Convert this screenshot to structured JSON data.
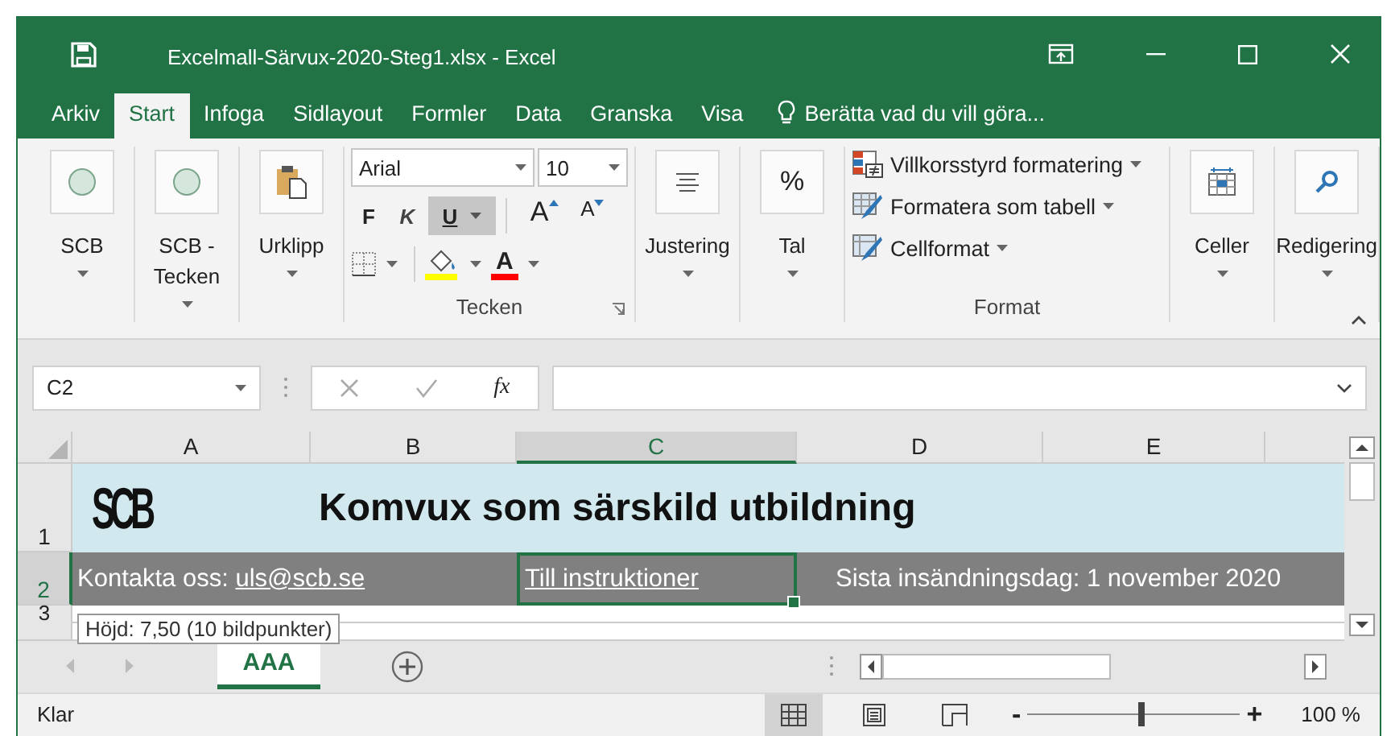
{
  "window": {
    "title": "Excelmall-Särvux-2020-Steg1.xlsx - Excel"
  },
  "menu_tabs": [
    {
      "label": "Arkiv",
      "selected": false
    },
    {
      "label": "Start",
      "selected": true
    },
    {
      "label": "Infoga",
      "selected": false
    },
    {
      "label": "Sidlayout",
      "selected": false
    },
    {
      "label": "Formler",
      "selected": false
    },
    {
      "label": "Data",
      "selected": false
    },
    {
      "label": "Granska",
      "selected": false
    },
    {
      "label": "Visa",
      "selected": false
    }
  ],
  "tell_me": "Berätta vad du vill göra...",
  "ribbon": {
    "left_buttons": [
      {
        "label": "SCB",
        "kind": "style"
      },
      {
        "label": "SCB - Tecken",
        "kind": "style"
      },
      {
        "label": "Urklipp",
        "kind": "clipboard"
      }
    ],
    "font_group": {
      "font": "Arial",
      "size": "10",
      "bold": "F",
      "italic": "K",
      "underline": "U",
      "underline_on": true,
      "grow": "A",
      "shrink": "A",
      "font_color": "A",
      "label": "Tecken"
    },
    "mid_buttons": [
      {
        "label": "Justering",
        "kind": "align"
      },
      {
        "label": "Tal",
        "kind": "number",
        "glyph": "%"
      }
    ],
    "format_group": {
      "items": [
        {
          "label": "Villkorsstyrd formatering",
          "kind": "conditional"
        },
        {
          "label": "Formatera som tabell",
          "kind": "table"
        },
        {
          "label": "Cellformat",
          "kind": "cellstyle"
        }
      ],
      "label": "Format"
    },
    "right_buttons": [
      {
        "label": "Celler",
        "kind": "cells"
      },
      {
        "label": "Redigering",
        "kind": "search"
      }
    ]
  },
  "formula_bar": {
    "name_box": "C2",
    "fx": "fx"
  },
  "sheet": {
    "columns": [
      {
        "label": "A",
        "selected": false
      },
      {
        "label": "B",
        "selected": false
      },
      {
        "label": "C",
        "selected": true
      },
      {
        "label": "D",
        "selected": false
      },
      {
        "label": "E",
        "selected": false
      }
    ],
    "rows": [
      {
        "label": "1",
        "selected": false
      },
      {
        "label": "2",
        "selected": true
      },
      {
        "label": "3",
        "selected": false
      }
    ],
    "logo": "SCB",
    "title": "Komvux som särskild utbildning",
    "contact_label": "Kontakta oss:",
    "contact_email": "uls@scb.se",
    "link": "Till instruktioner",
    "link_selected": true,
    "deadline": "Sista insändningsdag: 1 november 2020",
    "tooltip": "Höjd: 7,50 (10 bildpunkter)"
  },
  "sheet_tabs": [
    {
      "label": "AAA",
      "selected": true
    }
  ],
  "status_bar": {
    "status": "Klar",
    "views": [
      {
        "kind": "normal",
        "selected": true
      },
      {
        "kind": "layout",
        "selected": false
      },
      {
        "kind": "pagebreak",
        "selected": false
      }
    ],
    "zoom_minus": "-",
    "zoom_plus": "+",
    "level": 0.52,
    "zoom": "100 %"
  }
}
